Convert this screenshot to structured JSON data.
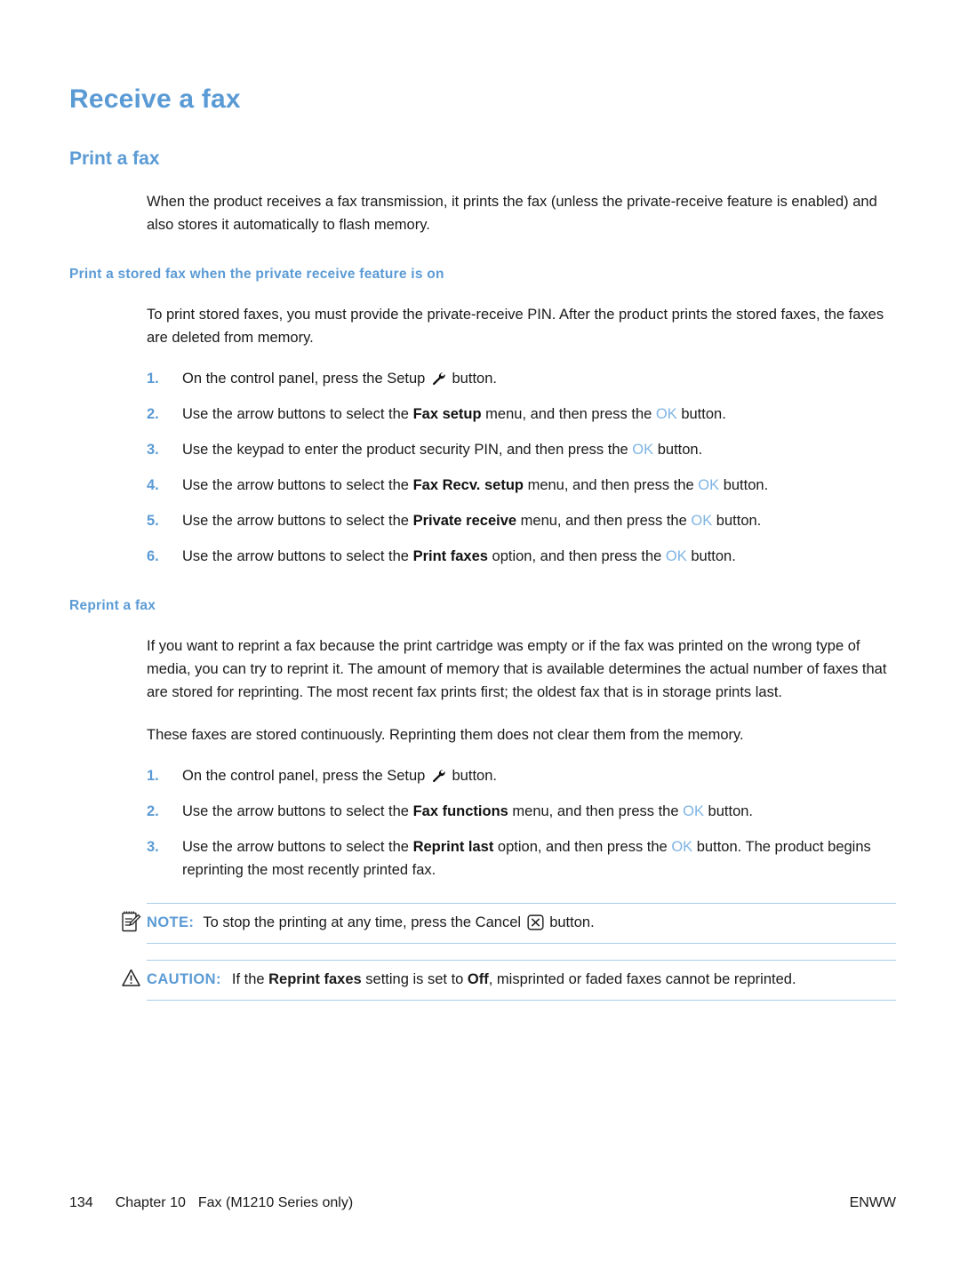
{
  "page": {
    "number": "134",
    "chapter": "Chapter 10",
    "chapter_title": "Fax (M1210 Series only)",
    "locale_code": "ENWW"
  },
  "colors": {
    "heading_blue": "#5b9bd5",
    "ok_blue": "#7fb4e3",
    "rule_blue": "#a9cdea",
    "body_text": "#1a1a1a",
    "background": "#ffffff"
  },
  "headings": {
    "h1": "Receive a fax",
    "h2_print_a_fax": "Print a fax",
    "h3_print_stored": "Print a stored fax when the private receive feature is on",
    "h3_reprint": "Reprint a fax"
  },
  "paragraphs": {
    "intro": "When the product receives a fax transmission, it prints the fax (unless the private-receive feature is enabled) and also stores it automatically to flash memory.",
    "stored_intro": "To print stored faxes, you must provide the private-receive PIN. After the product prints the stored faxes, the faxes are deleted from memory.",
    "reprint_intro": "If you want to reprint a fax because the print cartridge was empty or if the fax was printed on the wrong type of media, you can try to reprint it. The amount of memory that is available determines the actual number of faxes that are stored for reprinting. The most recent fax prints first; the oldest fax that is in storage prints last.",
    "reprint_stored": "These faxes are stored continuously. Reprinting them does not clear them from the memory."
  },
  "steps_private_receive": [
    {
      "num": "1.",
      "pre": "On the control panel, press the Setup ",
      "icon": "wrench-icon",
      "post": " button.",
      "bold": "",
      "mid": "",
      "ok": "",
      "tail": ""
    },
    {
      "num": "2.",
      "pre": "Use the arrow buttons to select the ",
      "bold": "Fax setup",
      "mid": " menu, and then press the ",
      "ok": "OK",
      "tail": " button."
    },
    {
      "num": "3.",
      "pre": "Use the keypad to enter the product security PIN, and then press the ",
      "bold": "",
      "mid": "",
      "ok": "OK",
      "tail": " button."
    },
    {
      "num": "4.",
      "pre": "Use the arrow buttons to select the ",
      "bold": "Fax Recv. setup",
      "mid": " menu, and then press the ",
      "ok": "OK",
      "tail": " button."
    },
    {
      "num": "5.",
      "pre": "Use the arrow buttons to select the ",
      "bold": "Private receive",
      "mid": " menu, and then press the ",
      "ok": "OK",
      "tail": " button."
    },
    {
      "num": "6.",
      "pre": "Use the arrow buttons to select the ",
      "bold": "Print faxes",
      "mid": " option, and then press the ",
      "ok": "OK",
      "tail": " button."
    }
  ],
  "steps_reprint": [
    {
      "num": "1.",
      "pre": "On the control panel, press the Setup ",
      "icon": "wrench-icon",
      "post": " button.",
      "bold": "",
      "mid": "",
      "ok": "",
      "tail": ""
    },
    {
      "num": "2.",
      "pre": "Use the arrow buttons to select the ",
      "bold": "Fax functions",
      "mid": " menu, and then press the ",
      "ok": "OK",
      "tail": " button."
    },
    {
      "num": "3.",
      "pre": "Use the arrow buttons to select the ",
      "bold": "Reprint last",
      "mid": " option, and then press the ",
      "ok": "OK",
      "tail": " button. The product begins reprinting the most recently printed fax."
    }
  ],
  "note": {
    "icon": "note-pad-pencil-icon",
    "label": "NOTE:",
    "text_before": "To stop the printing at any time, press the Cancel ",
    "inline_icon": "cancel-x-icon",
    "text_after": " button."
  },
  "caution": {
    "icon": "warning-triangle-icon",
    "label": "CAUTION:",
    "text_before": "If the ",
    "bold1": "Reprint faxes",
    "text_mid": " setting is set to ",
    "bold2": "Off",
    "text_after": ", misprinted or faded faxes cannot be reprinted."
  }
}
